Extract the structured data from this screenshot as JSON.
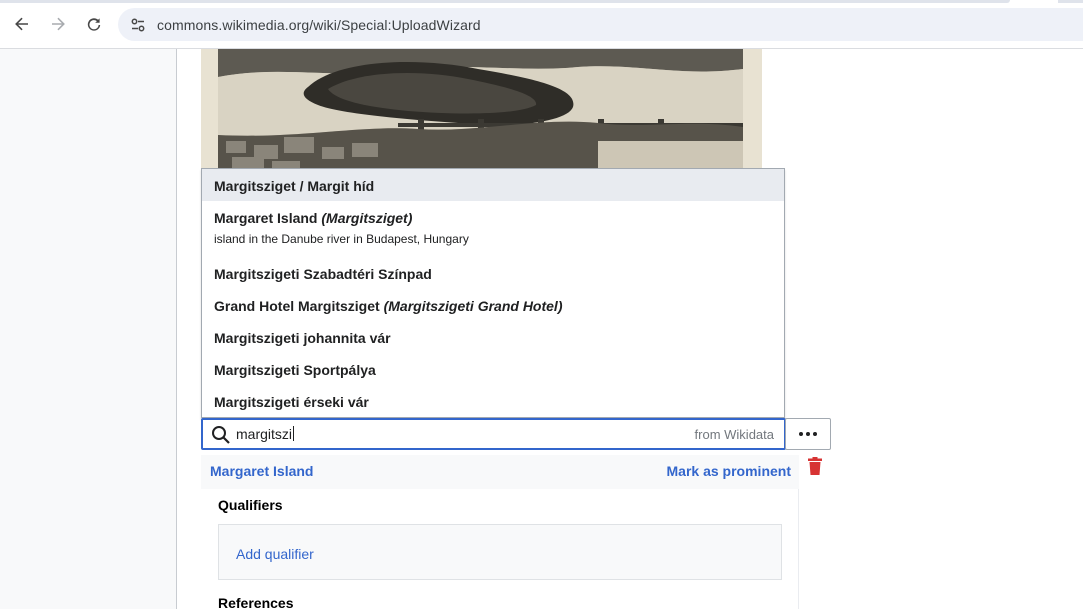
{
  "browser": {
    "url": "commons.wikimedia.org/wiki/Special:UploadWizard"
  },
  "suggestions": [
    {
      "label": "Margitsziget / Margit híd",
      "alias": "",
      "description": "",
      "highlighted": true
    },
    {
      "label": "Margaret Island",
      "alias": "(Margitsziget)",
      "description": "island in the Danube river in Budapest, Hungary",
      "highlighted": false
    },
    {
      "label": "Margitszigeti Szabadtéri Színpad",
      "alias": "",
      "description": "",
      "highlighted": false
    },
    {
      "label": "Grand Hotel Margitsziget",
      "alias": "(Margitszigeti Grand Hotel)",
      "description": "",
      "highlighted": false
    },
    {
      "label": "Margitszigeti johannita vár",
      "alias": "",
      "description": "",
      "highlighted": false
    },
    {
      "label": "Margitszigeti Sportpálya",
      "alias": "",
      "description": "",
      "highlighted": false
    },
    {
      "label": "Margitszigeti érseki vár",
      "alias": "",
      "description": "",
      "highlighted": false
    }
  ],
  "search": {
    "value": "margitszi",
    "source": "from Wikidata"
  },
  "statement": {
    "value": "Margaret Island",
    "prominent": "Mark as prominent"
  },
  "qualifiers": {
    "title": "Qualifiers",
    "add": "Add qualifier"
  },
  "references": {
    "title": "References"
  },
  "colors": {
    "link": "#3366cc",
    "highlight": "#e8ebf0",
    "delete": "#d73333",
    "focus_border": "#3366cc"
  }
}
